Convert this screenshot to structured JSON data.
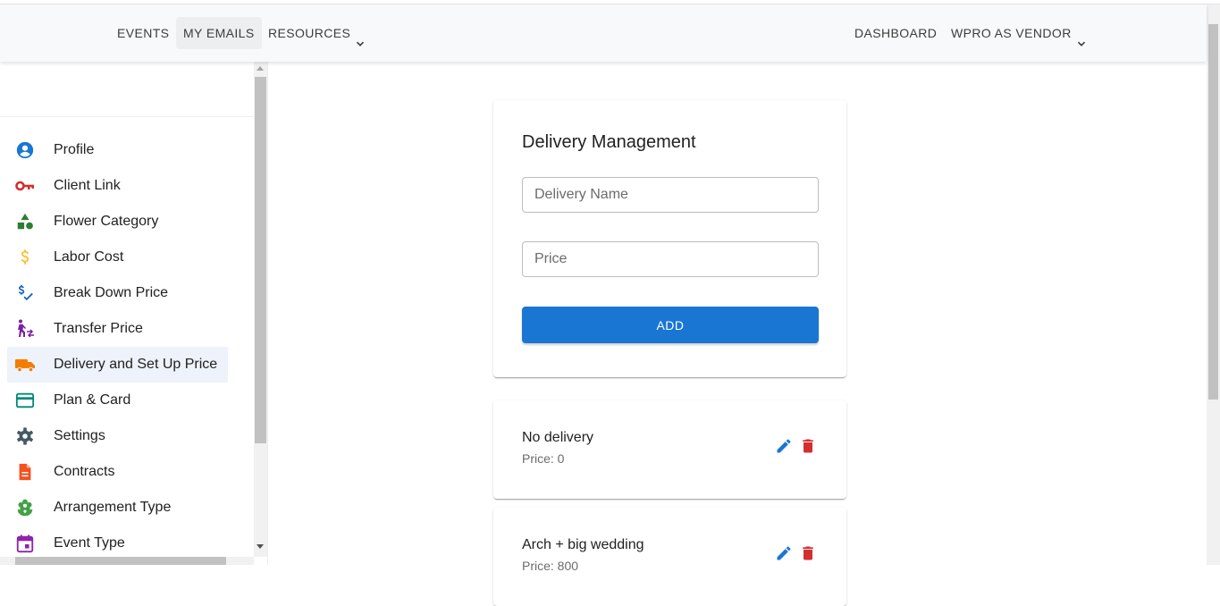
{
  "nav": {
    "events": "EVENTS",
    "my_emails": "MY EMAILS",
    "resources": "RESOURCES",
    "dashboard": "DASHBOARD",
    "vendor": "WPRO AS VENDOR"
  },
  "sidebar": {
    "items": [
      {
        "label": "Profile",
        "icon": "account-circle-icon",
        "color": "#1976d2"
      },
      {
        "label": "Client Link",
        "icon": "key-icon",
        "color": "#d32f2f"
      },
      {
        "label": "Flower Category",
        "icon": "category-shapes-icon",
        "color": "#2e7d32"
      },
      {
        "label": "Labor Cost",
        "icon": "dollar-icon",
        "color": "#fbc02d"
      },
      {
        "label": "Break Down Price",
        "icon": "price-check-icon",
        "color": "#1565c0"
      },
      {
        "label": "Transfer Price",
        "icon": "transfer-within-station-icon",
        "color": "#7b1fa2"
      },
      {
        "label": "Delivery and Set Up Price",
        "icon": "truck-icon",
        "color": "#f57c00"
      },
      {
        "label": "Plan & Card",
        "icon": "credit-card-icon",
        "color": "#00897b"
      },
      {
        "label": "Settings",
        "icon": "gear-icon",
        "color": "#455a64"
      },
      {
        "label": "Contracts",
        "icon": "document-icon",
        "color": "#f4511e"
      },
      {
        "label": "Arrangement Type",
        "icon": "flower-icon",
        "color": "#43a047"
      },
      {
        "label": "Event Type",
        "icon": "calendar-icon",
        "color": "#8e24aa"
      }
    ],
    "selected_index": 6
  },
  "form": {
    "title": "Delivery Management",
    "name_placeholder": "Delivery Name",
    "name_value": "",
    "price_placeholder": "Price",
    "price_value": "",
    "add_label": "ADD"
  },
  "deliveries": [
    {
      "name": "No delivery",
      "price": "Price: 0"
    },
    {
      "name": "Arch + big wedding",
      "price": "Price: 800"
    }
  ],
  "colors": {
    "primary": "#1976d2",
    "delete": "#d32f2f",
    "selected_bg": "#edf2fb"
  }
}
